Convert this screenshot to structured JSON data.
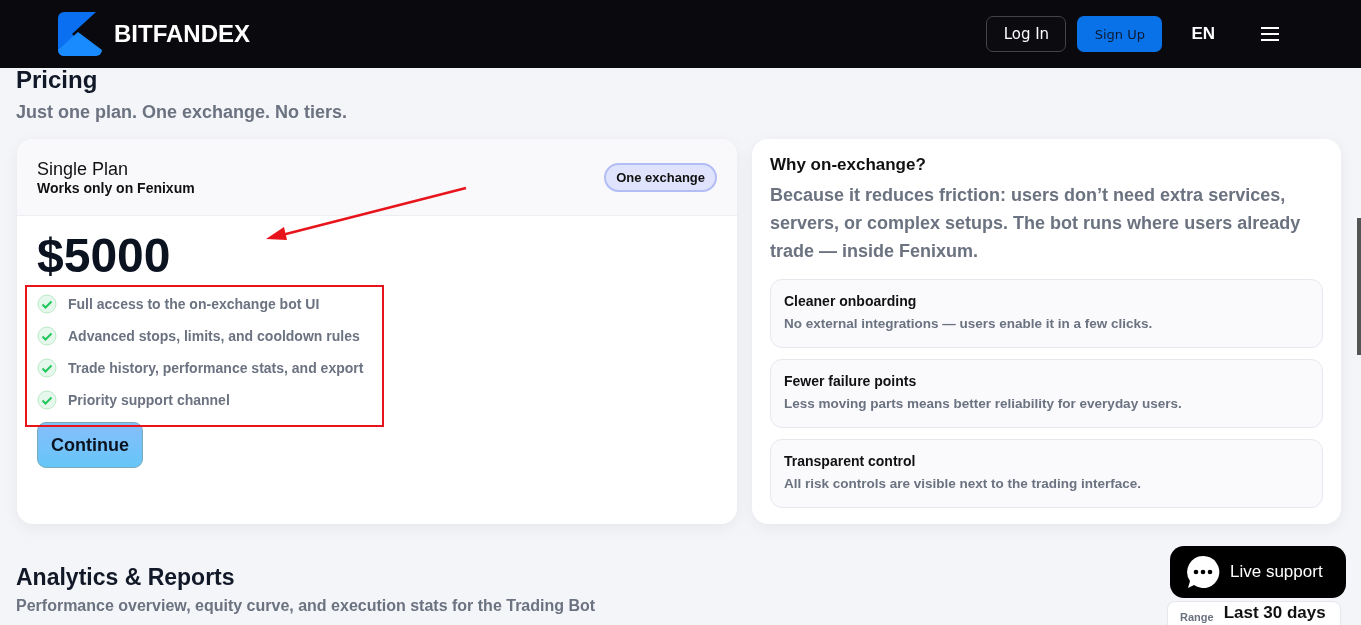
{
  "header": {
    "brand": "BITFANDEX",
    "login": "Log In",
    "signup": "Sign Up",
    "language": "EN"
  },
  "pricing": {
    "title": "Pricing",
    "subtitle": "Just one plan. One exchange. No tiers."
  },
  "plan": {
    "name": "Single Plan",
    "note": "Works only on Fenixum",
    "badge": "One exchange",
    "price": "$5000",
    "features": [
      {
        "text": "Full access to the on-exchange bot UI",
        "included": true
      },
      {
        "text": "Advanced stops, limits, and cooldown rules",
        "included": true
      },
      {
        "text": "Trade history, performance stats, and export",
        "included": true
      },
      {
        "text": "Priority support channel",
        "included": true
      }
    ],
    "button": "Continue"
  },
  "why": {
    "title": "Why on-exchange?",
    "text": "Because it reduces friction: users don’t need extra services, servers, or complex setups. The bot runs where users already trade — inside Fenixum.",
    "points": [
      {
        "title": "Cleaner onboarding",
        "text": "No external integrations — users enable it in a few clicks."
      },
      {
        "title": "Fewer failure points",
        "text": "Less moving parts means better reliability for everyday users."
      },
      {
        "title": "Transparent control",
        "text": "All risk controls are visible next to the trading interface."
      }
    ]
  },
  "analytics": {
    "title": "Analytics & Reports",
    "subtitle": "Performance overview, equity curve, and execution stats for the Trading Bot",
    "range_label": "Range",
    "range_value": "Last 30 days"
  },
  "chat": {
    "label": "Live support"
  }
}
